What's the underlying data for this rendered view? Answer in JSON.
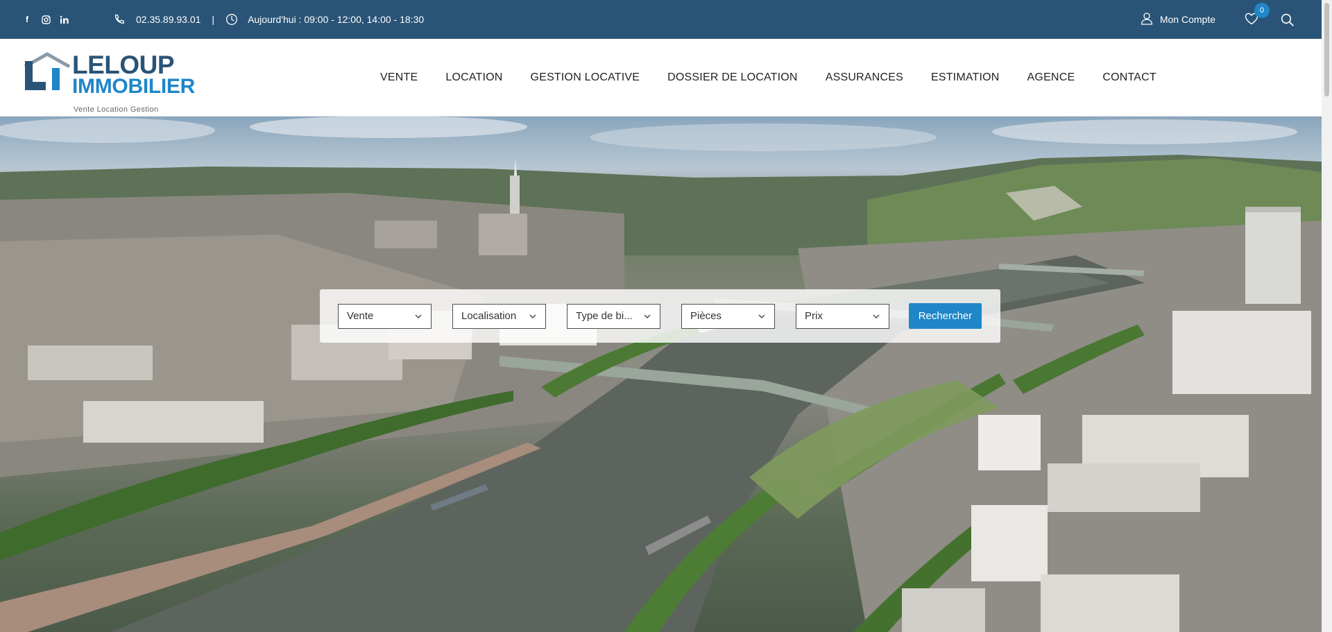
{
  "topbar": {
    "phone": "02.35.89.93.01",
    "separator": "|",
    "hours": "Aujourd'hui : 09:00 - 12:00, 14:00 - 18:30",
    "account_label": "Mon Compte",
    "favorites_count": "0"
  },
  "logo": {
    "line1": "LELOUP",
    "line2": "IMMOBILIER",
    "tagline": "Vente  Location  Gestion"
  },
  "nav": {
    "items": [
      "VENTE",
      "LOCATION",
      "GESTION LOCATIVE",
      "DOSSIER DE LOCATION",
      "ASSURANCES",
      "ESTIMATION",
      "AGENCE",
      "CONTACT"
    ]
  },
  "search": {
    "transaction": "Vente",
    "location": "Localisation",
    "property_type": "Type de bi...",
    "rooms": "Pièces",
    "price": "Prix",
    "submit_label": "Rechercher"
  },
  "colors": {
    "topbar": "#2a5477",
    "accent": "#1f86c8",
    "brand_dark": "#2a5477"
  }
}
